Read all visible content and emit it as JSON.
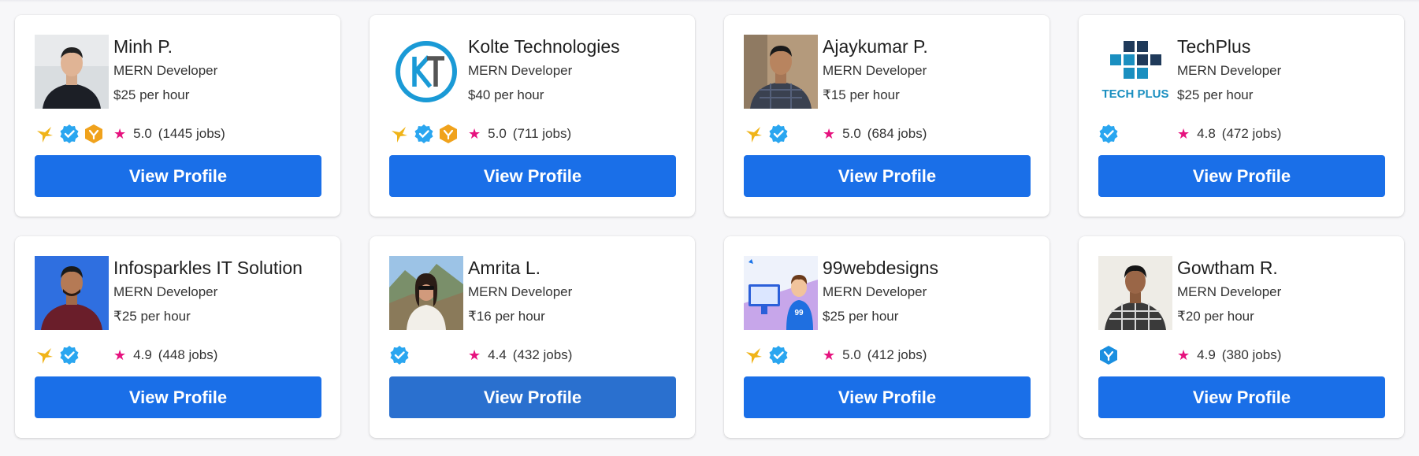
{
  "colors": {
    "button": "#1a6fe8",
    "button_hover": "#2a70cf",
    "star": "#e6127e",
    "verified": "#2aa6f0",
    "preferred": "#f0a21c"
  },
  "cards": [
    {
      "name": "Minh P.",
      "role": "MERN Developer",
      "rate": "$25 per hour",
      "score": "5.0",
      "jobs": "(1445 jobs)",
      "badges": [
        "plus-bird-icon",
        "verified-icon",
        "preferred-icon"
      ],
      "avatar": "photo-man-black-shirt",
      "button": "View Profile"
    },
    {
      "name": "Kolte Technologies",
      "role": "MERN Developer",
      "rate": "$40 per hour",
      "score": "5.0",
      "jobs": "(711 jobs)",
      "badges": [
        "plus-bird-icon",
        "verified-icon",
        "preferred-icon"
      ],
      "avatar": "logo-kt",
      "button": "View Profile"
    },
    {
      "name": "Ajaykumar P.",
      "role": "MERN Developer",
      "rate": "₹15 per hour",
      "score": "5.0",
      "jobs": "(684 jobs)",
      "badges": [
        "plus-bird-icon",
        "verified-icon"
      ],
      "avatar": "photo-man-plaid",
      "button": "View Profile"
    },
    {
      "name": "TechPlus",
      "role": "MERN Developer",
      "rate": "$25 per hour",
      "score": "4.8",
      "jobs": "(472 jobs)",
      "badges": [
        "verified-icon"
      ],
      "avatar": "logo-techplus",
      "avatar_text": "TECH PLUS",
      "button": "View Profile"
    },
    {
      "name": "Infosparkles IT Solution",
      "role": "MERN Developer",
      "rate": "₹25 per hour",
      "score": "4.9",
      "jobs": "(448 jobs)",
      "badges": [
        "plus-bird-icon",
        "verified-icon"
      ],
      "avatar": "photo-man-blue-bg",
      "button": "View Profile"
    },
    {
      "name": "Amrita L.",
      "role": "MERN Developer",
      "rate": "₹16 per hour",
      "score": "4.4",
      "jobs": "(432 jobs)",
      "badges": [
        "verified-icon"
      ],
      "avatar": "photo-woman-mountains",
      "button": "View Profile"
    },
    {
      "name": "99webdesigns",
      "role": "MERN Developer",
      "rate": "$25 per hour",
      "score": "5.0",
      "jobs": "(412 jobs)",
      "badges": [
        "plus-bird-icon",
        "verified-icon"
      ],
      "avatar": "illustration-99webdesigns",
      "button": "View Profile"
    },
    {
      "name": "Gowtham R.",
      "role": "MERN Developer",
      "rate": "₹20 per hour",
      "score": "4.9",
      "jobs": "(380 jobs)",
      "badges": [
        "verified-shield-icon"
      ],
      "avatar": "photo-man-checkered",
      "button": "View Profile"
    }
  ]
}
